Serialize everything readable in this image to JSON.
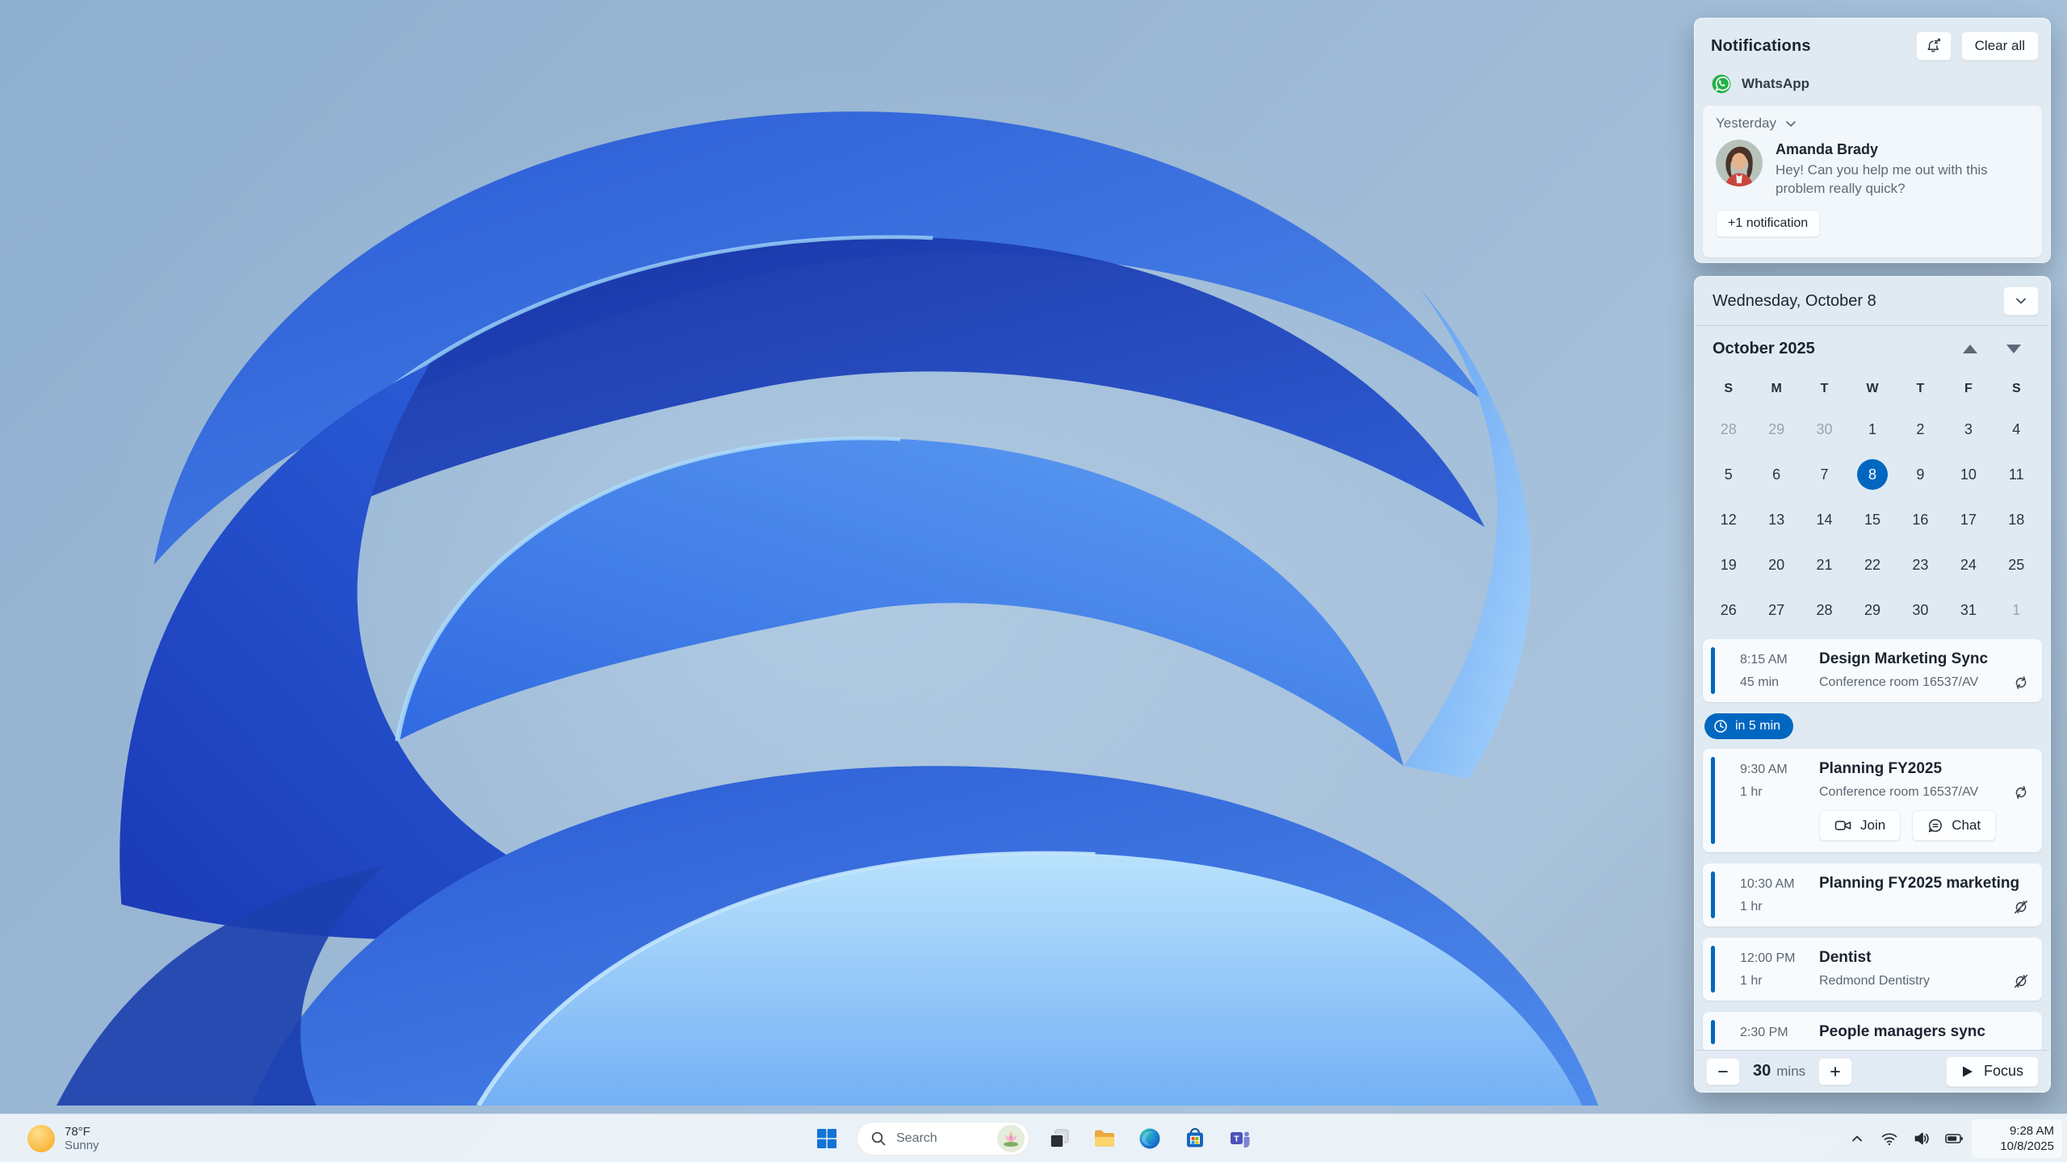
{
  "colors": {
    "accent": "#0067c0",
    "whatsapp_green": "#25b049",
    "selected_day_bg": "#0067c0"
  },
  "icons": {
    "notification_settings": "bell-snooze-icon",
    "whatsapp": "whatsapp-icon",
    "group_collapse": "chevron-down-icon",
    "calendar_collapse": "chevron-down-icon",
    "month_prev": "triangle-up-icon",
    "month_next": "triangle-down-icon",
    "reminder": "clock-icon",
    "recurring": "recurrence-icon",
    "recurring_off": "recurrence-off-icon",
    "join": "video-camera-icon",
    "chat": "chat-bubble-icon",
    "focus": "play-icon",
    "weather": "sun-icon",
    "start": "windows-logo-icon",
    "search": "magnifier-icon",
    "search_highlight": "lotus-icon",
    "task_view": "task-view-icon",
    "file_explorer": "folder-icon",
    "edge": "edge-icon",
    "store": "store-bag-icon",
    "teams": "teams-icon",
    "tray_expand": "chevron-up-icon",
    "network": "wifi-icon",
    "sound": "speaker-icon",
    "power": "battery-icon"
  },
  "notifications": {
    "title": "Notifications",
    "clear_all_label": "Clear all",
    "app_name": "WhatsApp",
    "group_label": "Yesterday",
    "sender": "Amanda Brady",
    "message": "Hey! Can you help me out with this problem really quick?",
    "more_label": "+1 notification"
  },
  "calendar": {
    "header_date": "Wednesday, October 8",
    "month_label": "October 2025",
    "day_headers": [
      "S",
      "M",
      "T",
      "W",
      "T",
      "F",
      "S"
    ],
    "days": [
      {
        "n": 28,
        "muted": true
      },
      {
        "n": 29,
        "muted": true
      },
      {
        "n": 30,
        "muted": true
      },
      {
        "n": 1
      },
      {
        "n": 2
      },
      {
        "n": 3
      },
      {
        "n": 4
      },
      {
        "n": 5
      },
      {
        "n": 6
      },
      {
        "n": 7
      },
      {
        "n": 8,
        "selected": true
      },
      {
        "n": 9
      },
      {
        "n": 10
      },
      {
        "n": 11
      },
      {
        "n": 12
      },
      {
        "n": 13
      },
      {
        "n": 14
      },
      {
        "n": 15
      },
      {
        "n": 16
      },
      {
        "n": 17
      },
      {
        "n": 18
      },
      {
        "n": 19
      },
      {
        "n": 20
      },
      {
        "n": 21
      },
      {
        "n": 22
      },
      {
        "n": 23
      },
      {
        "n": 24
      },
      {
        "n": 25
      },
      {
        "n": 26
      },
      {
        "n": 27
      },
      {
        "n": 28
      },
      {
        "n": 29
      },
      {
        "n": 30
      },
      {
        "n": 31
      },
      {
        "n": 1,
        "muted": true
      }
    ]
  },
  "agenda": {
    "join_label": "Join",
    "chat_label": "Chat",
    "items": [
      {
        "time": "8:15 AM",
        "duration": "45 min",
        "title": "Design Marketing Sync",
        "location": "Conference room 16537/AV",
        "recurring": true
      },
      {
        "chip": "in 5 min",
        "time": "9:30 AM",
        "duration": "1 hr",
        "title": "Planning FY2025",
        "location": "Conference room 16537/AV",
        "recurring": true,
        "buttons": true
      },
      {
        "time": "10:30 AM",
        "duration": "1 hr",
        "title": "Planning FY2025 marketing",
        "recurring_off": true
      },
      {
        "time": "12:00 PM",
        "duration": "1 hr",
        "title": "Dentist",
        "location": "Redmond Dentistry",
        "recurring_off": true
      },
      {
        "time": "2:30 PM",
        "title": "People managers sync"
      }
    ]
  },
  "focus_bar": {
    "minutes": "30",
    "unit": "mins",
    "focus_label": "Focus"
  },
  "taskbar": {
    "weather_temp": "78°F",
    "weather_condition": "Sunny",
    "search_placeholder": "Search",
    "tray_time": "9:28 AM",
    "tray_date": "10/8/2025"
  }
}
